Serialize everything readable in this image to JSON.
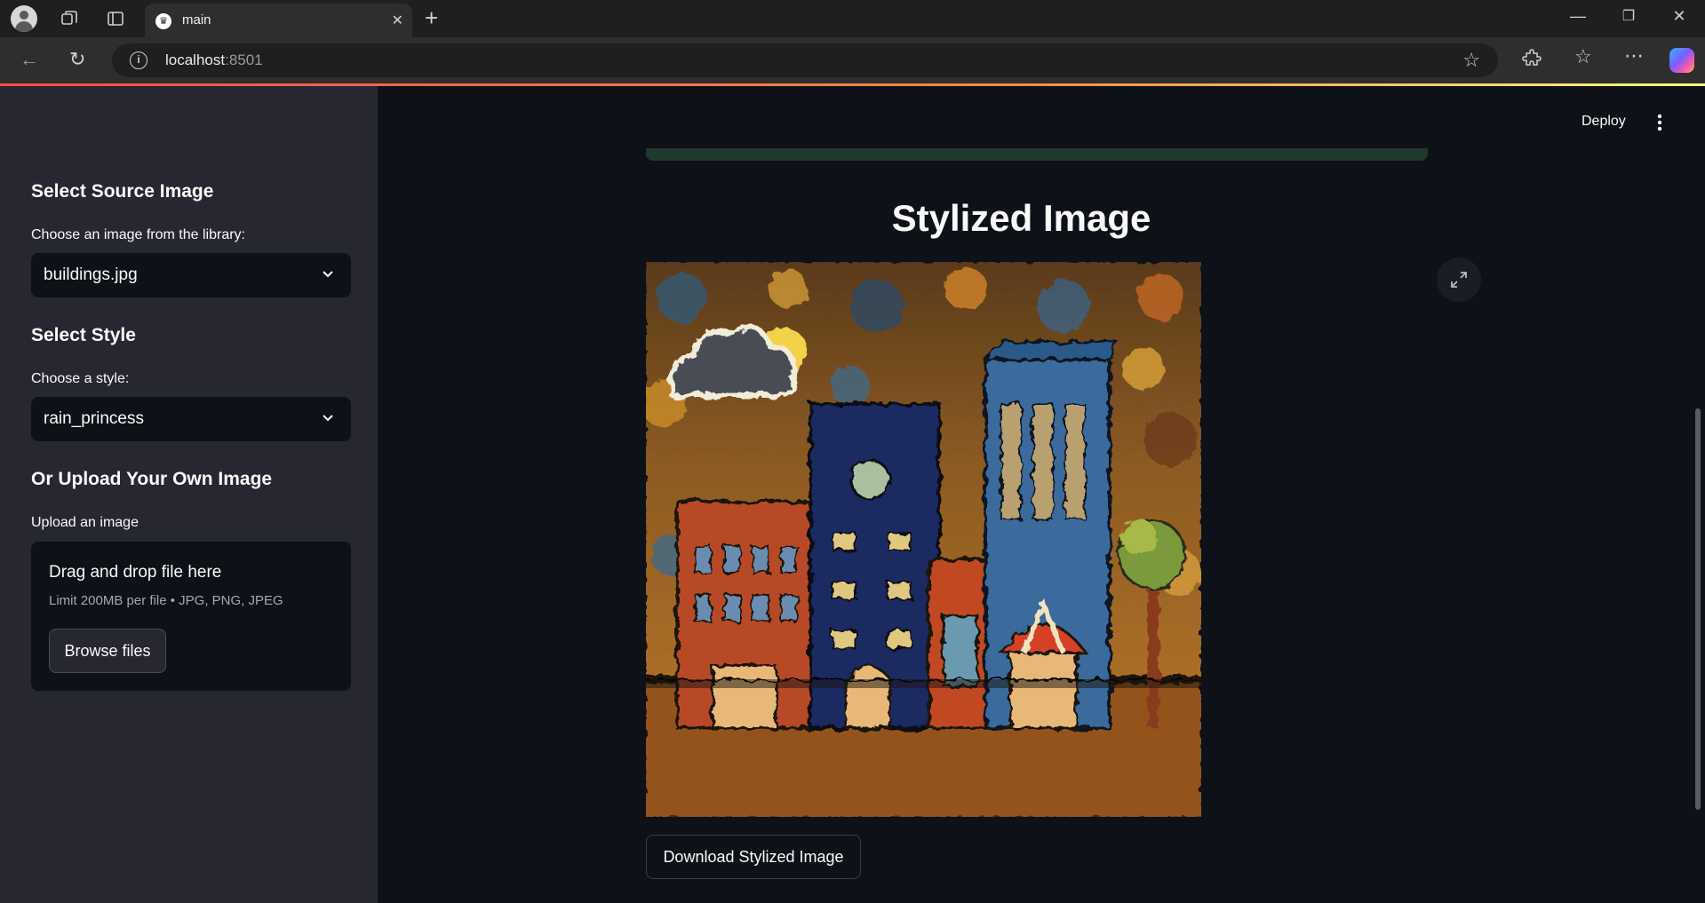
{
  "browser": {
    "tab_title": "main",
    "url_host": "localhost",
    "url_port": ":8501"
  },
  "sidebar": {
    "source_heading": "Select Source Image",
    "library_label": "Choose an image from the library:",
    "library_value": "buildings.jpg",
    "style_heading": "Select Style",
    "style_label": "Choose a style:",
    "style_value": "rain_princess",
    "upload_heading": "Or Upload Your Own Image",
    "upload_label": "Upload an image",
    "dropzone_title": "Drag and drop file here",
    "dropzone_limit": "Limit 200MB per file • JPG, PNG, JPEG",
    "browse_label": "Browse files"
  },
  "toolbar": {
    "deploy_label": "Deploy"
  },
  "main": {
    "title": "Stylized Image",
    "download_label": "Download Stylized Image"
  },
  "colors": {
    "background": "#0e1117",
    "sidebar": "#262730",
    "accent_red": "#ff4b4b"
  }
}
